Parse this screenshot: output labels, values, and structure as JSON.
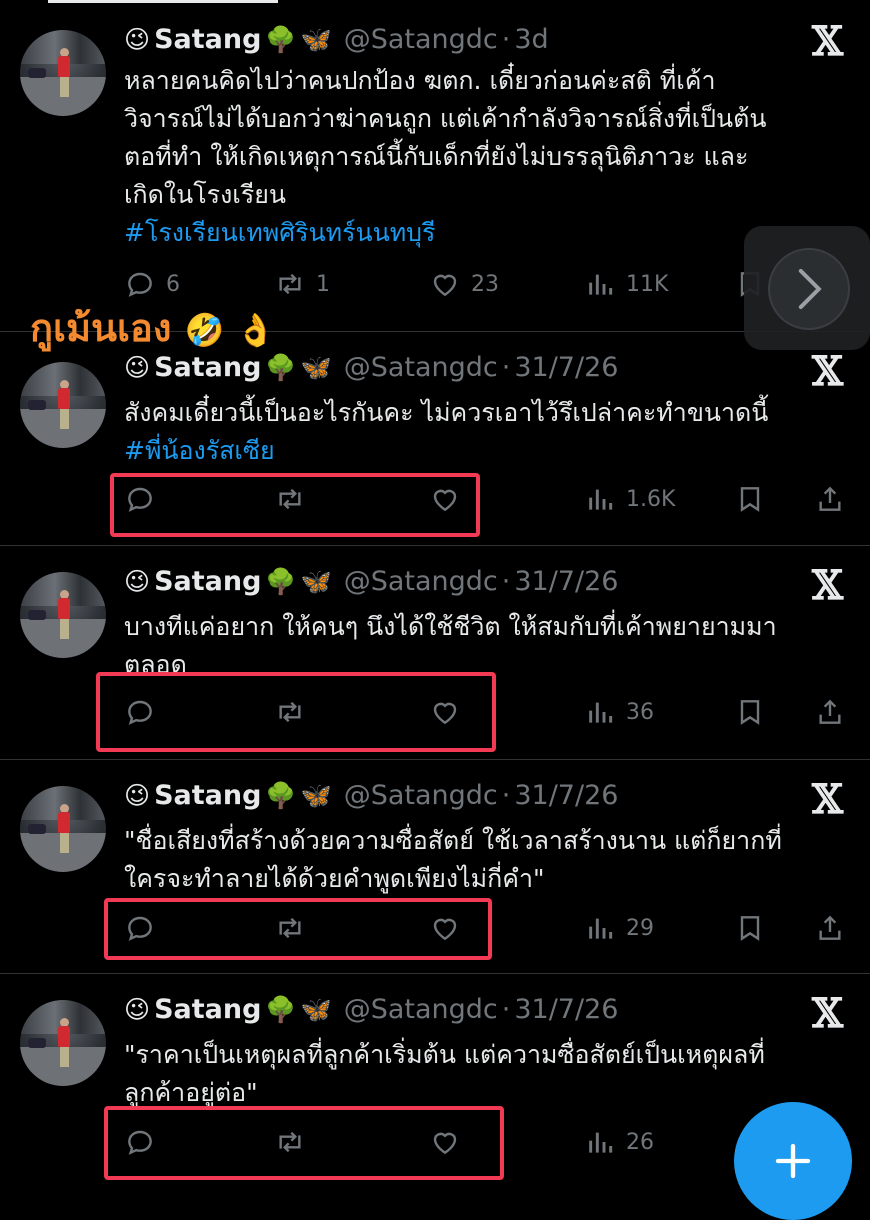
{
  "overlay_text": {
    "label": "กูเม้นเอง",
    "emoji": "🤣 👌"
  },
  "tweets": [
    {
      "name": "Satang",
      "handle": "@Satangdc",
      "sep": "·",
      "time": "3d",
      "text_lines": [
        "หลายคนคิดไปว่าคนปกป้อง ฆตก. เดี๋ยวก่อนค่ะสติ ที่เค้า",
        "วิจารณ์ไม่ได้บอกว่าฆ่าคนถูก แต่เค้ากำลังวิจารณ์สิ่งที่เป็นต้น",
        "ตอที่ทำ ให้เกิดเหตุการณ์นี้กับเด็กที่ยังไม่บรรลุนิติภาวะ และ",
        "เกิดในโรงเรียน"
      ],
      "hashtag": "#โรงเรียนเทพศิรินทร์นนทบุรี",
      "replies": "6",
      "reposts": "1",
      "likes": "23",
      "views": "11K"
    },
    {
      "name": "Satang",
      "handle": "@Satangdc",
      "sep": "·",
      "time": "31/7/26",
      "text_lines": [
        "สังคมเดี๋ยวนี้เป็นอะไรกันคะ ไม่ควรเอาไว้รึเปล่าคะทำขนาดนี้"
      ],
      "hashtag": "#พี่น้องรัสเซีย",
      "views": "1.6K"
    },
    {
      "name": "Satang",
      "handle": "@Satangdc",
      "sep": "·",
      "time": "31/7/26",
      "text_lines": [
        "บางทีแค่อยาก ให้คนๆ นึงได้ใช้ชีวิต ให้สมกับที่เค้าพยายามมา",
        "ตลอด"
      ],
      "views": "36"
    },
    {
      "name": "Satang",
      "handle": "@Satangdc",
      "sep": "·",
      "time": "31/7/26",
      "text_lines": [
        "\"ชื่อเสียงที่สร้างด้วยความซื่อสัตย์ ใช้เวลาสร้างนาน แต่ก็ยากที่",
        "ใครจะทำลายได้ด้วยคำพูดเพียงไม่กี่คำ\""
      ],
      "views": "29"
    },
    {
      "name": "Satang",
      "handle": "@Satangdc",
      "sep": "·",
      "time": "31/7/26",
      "text_lines": [
        "\"ราคาเป็นเหตุผลที่ลูกค้าเริ่มต้น แต่ความซื่อสัตย์เป็นเหตุผลที่",
        "ลูกค้าอยู่ต่อ\""
      ],
      "views": "26"
    }
  ],
  "emoji": {
    "wink": "😉",
    "tree": "🌳",
    "butterfly": "🦋"
  },
  "icons": {
    "x_logo": "𝕏",
    "next": "chevron-right",
    "compose": "plus"
  },
  "colors": {
    "background": "#000000",
    "accent": "#1d9bf0",
    "muted": "#71767b",
    "highlight_box": "#f23a55",
    "overlay_text": "#f48a30"
  }
}
